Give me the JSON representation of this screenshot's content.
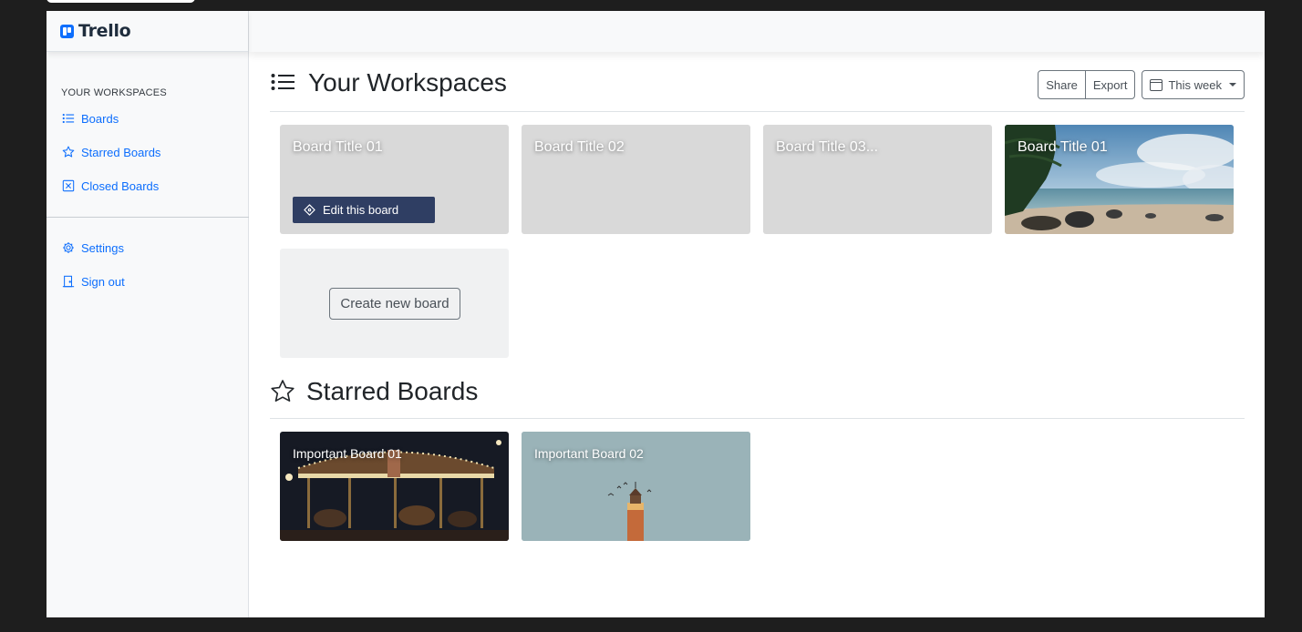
{
  "brand": {
    "name": "Trello"
  },
  "sidebar": {
    "heading": "YOUR WORKSPACES",
    "items": [
      {
        "label": "Boards",
        "icon": "list-icon"
      },
      {
        "label": "Starred Boards",
        "icon": "star-icon"
      },
      {
        "label": "Closed Boards",
        "icon": "x-square-icon"
      }
    ],
    "bottom_items": [
      {
        "label": "Settings",
        "icon": "gear-icon"
      },
      {
        "label": "Sign out",
        "icon": "door-icon"
      }
    ]
  },
  "workspaces": {
    "title": "Your Workspaces",
    "toolbar": {
      "share": "Share",
      "export": "Export",
      "range": "This week"
    },
    "boards": [
      {
        "title": "Board Title 01",
        "action": "Edit this board"
      },
      {
        "title": "Board Title 02"
      },
      {
        "title": "Board Title 03..."
      },
      {
        "title": "Board Title 01"
      }
    ],
    "create_label": "Create new board"
  },
  "starred": {
    "title": "Starred Boards",
    "boards": [
      {
        "title": "Important Board 01"
      },
      {
        "title": "Important Board 02"
      }
    ]
  },
  "colors": {
    "accent": "#0d6efd",
    "edit_button": "#2f3e63"
  }
}
